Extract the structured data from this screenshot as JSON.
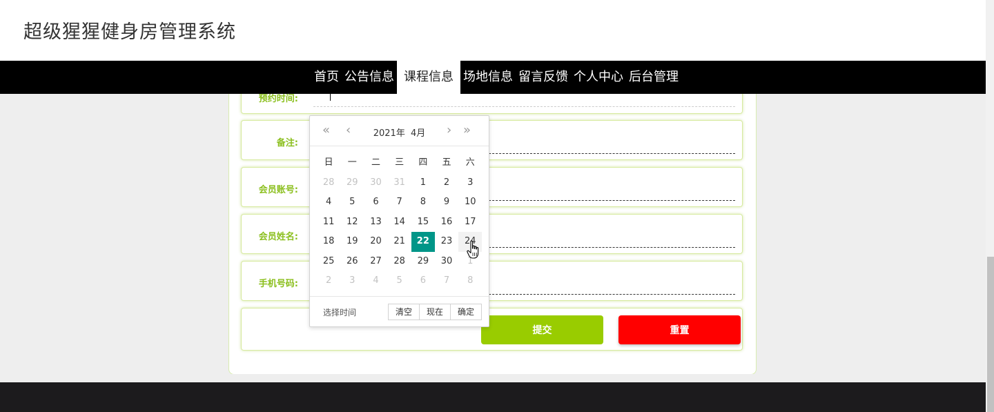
{
  "site": {
    "title": "超级猩猩健身房管理系统"
  },
  "nav": {
    "items": [
      {
        "label": "首页",
        "active": false
      },
      {
        "label": "公告信息",
        "active": false
      },
      {
        "label": "课程信息",
        "active": true
      },
      {
        "label": "场地信息",
        "active": false
      },
      {
        "label": "留言反馈",
        "active": false
      },
      {
        "label": "个人中心",
        "active": false
      },
      {
        "label": "后台管理",
        "active": false
      }
    ]
  },
  "form": {
    "fields": [
      {
        "label": "预约时间:",
        "value": ""
      },
      {
        "label": "备注:",
        "value": ""
      },
      {
        "label": "会员账号:",
        "value": ""
      },
      {
        "label": "会员姓名:",
        "value": ""
      },
      {
        "label": "手机号码:",
        "value": ""
      }
    ],
    "submit_label": "提交",
    "reset_label": "重置"
  },
  "datepicker": {
    "year": "2021年",
    "month": "4月",
    "weekdays": [
      "日",
      "一",
      "二",
      "三",
      "四",
      "五",
      "六"
    ],
    "weeks": [
      [
        "28",
        "29",
        "30",
        "31",
        "1",
        "2",
        "3"
      ],
      [
        "4",
        "5",
        "6",
        "7",
        "8",
        "9",
        "10"
      ],
      [
        "11",
        "12",
        "13",
        "14",
        "15",
        "16",
        "17"
      ],
      [
        "18",
        "19",
        "20",
        "21",
        "22",
        "23",
        "24"
      ],
      [
        "25",
        "26",
        "27",
        "28",
        "29",
        "30",
        "1"
      ],
      [
        "2",
        "3",
        "4",
        "5",
        "6",
        "7",
        "8"
      ]
    ],
    "selected_day": "22",
    "hover_day": "24",
    "choose_time_label": "选择时间",
    "clear_label": "清空",
    "now_label": "现在",
    "confirm_label": "确定"
  },
  "colors": {
    "accent_green": "#99cc00",
    "label_green": "#8bbf1e",
    "reset_red": "#ff0000",
    "selected_teal": "#009688",
    "nav_bg": "#000000",
    "footer_bg": "#1c1b1d"
  }
}
